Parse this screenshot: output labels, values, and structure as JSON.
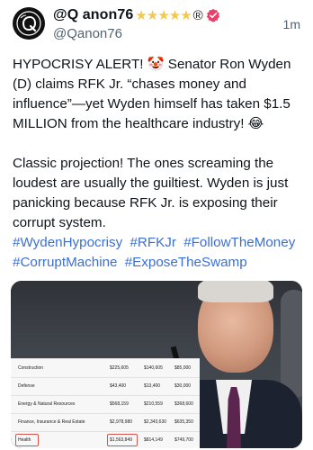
{
  "post": {
    "display_name": "@Q anon76",
    "stars": "★★★★★",
    "registered": "®",
    "handle": "@Qanon76",
    "timestamp": "1m",
    "paragraph1": "HYPOCRISY ALERT! 🤡 Senator Ron Wyden (D) claims RFK Jr. “chases money and influence”—yet Wyden himself has taken $1.5 MILLION from the healthcare industry! 😂",
    "paragraph2": "Classic projection! The ones screaming the loudest are usually the guiltiest. Wyden is just panicking because RFK Jr. is exposing their corrupt system.",
    "hashtags": [
      "#WydenHypocrisy",
      "#RFKJr",
      "#FollowTheMoney",
      "#CorruptMachine",
      "#ExposeTheSwamp"
    ]
  },
  "colors": {
    "hashtag": "#3b6fd6",
    "verified_badge": "#e8406a",
    "stars": "#f2c94c",
    "highlight_box": "#d9534f"
  },
  "icons": {
    "avatar": "q-logo-avatar-icon",
    "verified": "verified-badge-icon"
  },
  "media": {
    "table_rows": [
      {
        "industry": "Construction",
        "v1": "$225,605",
        "v2": "$140,605",
        "v3": "$85,000"
      },
      {
        "industry": "Defense",
        "v1": "$43,400",
        "v2": "$13,400",
        "v3": "$30,000"
      },
      {
        "industry": "Energy & Natural Resources",
        "v1": "$568,159",
        "v2": "$210,559",
        "v3": "$368,600"
      },
      {
        "industry": "Finance, Insurance & Real Estate",
        "v1": "$2,978,980",
        "v2": "$2,343,630",
        "v3": "$635,350"
      },
      {
        "industry": "Health",
        "v1": "$1,563,849",
        "v2": "$814,149",
        "v3": "$749,700"
      }
    ]
  }
}
